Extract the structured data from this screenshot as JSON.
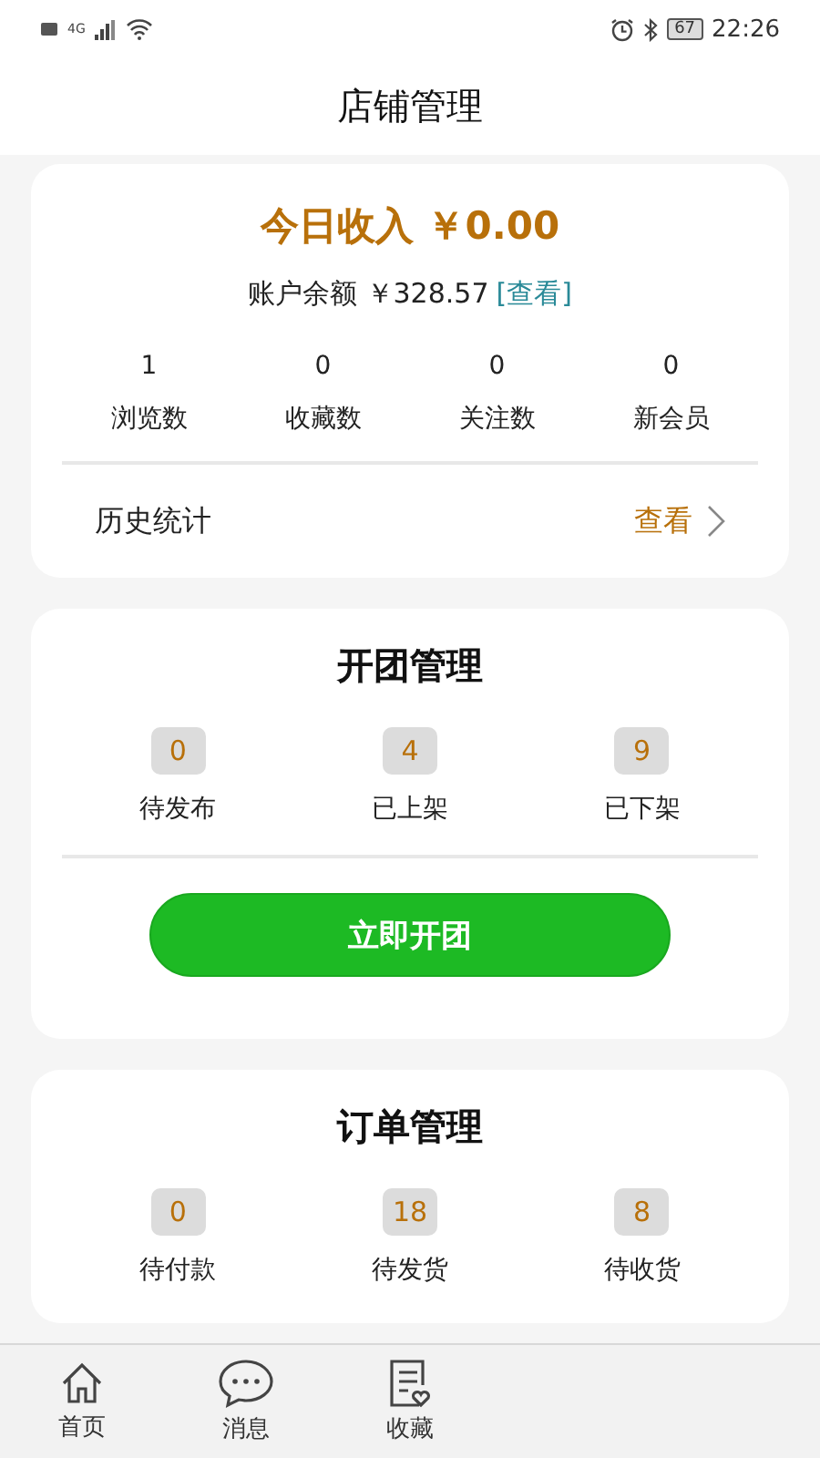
{
  "status_bar": {
    "network": "4G",
    "battery": "67",
    "time": "22:26"
  },
  "header": {
    "title": "店铺管理"
  },
  "income_card": {
    "today_income": "今日收入 ￥0.00",
    "balance_label": "账户余额 ￥328.57",
    "balance_link": "[查看]",
    "stats": [
      {
        "value": "1",
        "label": "浏览数"
      },
      {
        "value": "0",
        "label": "收藏数"
      },
      {
        "value": "0",
        "label": "关注数"
      },
      {
        "value": "0",
        "label": "新会员"
      }
    ],
    "history": {
      "label": "历史统计",
      "action": "查看"
    }
  },
  "group_card": {
    "title": "开团管理",
    "counts": [
      {
        "value": "0",
        "label": "待发布"
      },
      {
        "value": "4",
        "label": "已上架"
      },
      {
        "value": "9",
        "label": "已下架"
      }
    ],
    "button": "立即开团"
  },
  "order_card": {
    "title": "订单管理",
    "counts": [
      {
        "value": "0",
        "label": "待付款"
      },
      {
        "value": "18",
        "label": "待发货"
      },
      {
        "value": "8",
        "label": "待收货"
      }
    ]
  },
  "tab_bar": [
    {
      "kind": "home",
      "label": "首页",
      "selected": false
    },
    {
      "kind": "message",
      "label": "消息",
      "selected": false
    },
    {
      "kind": "favorite",
      "label": "收藏",
      "selected": false
    }
  ]
}
